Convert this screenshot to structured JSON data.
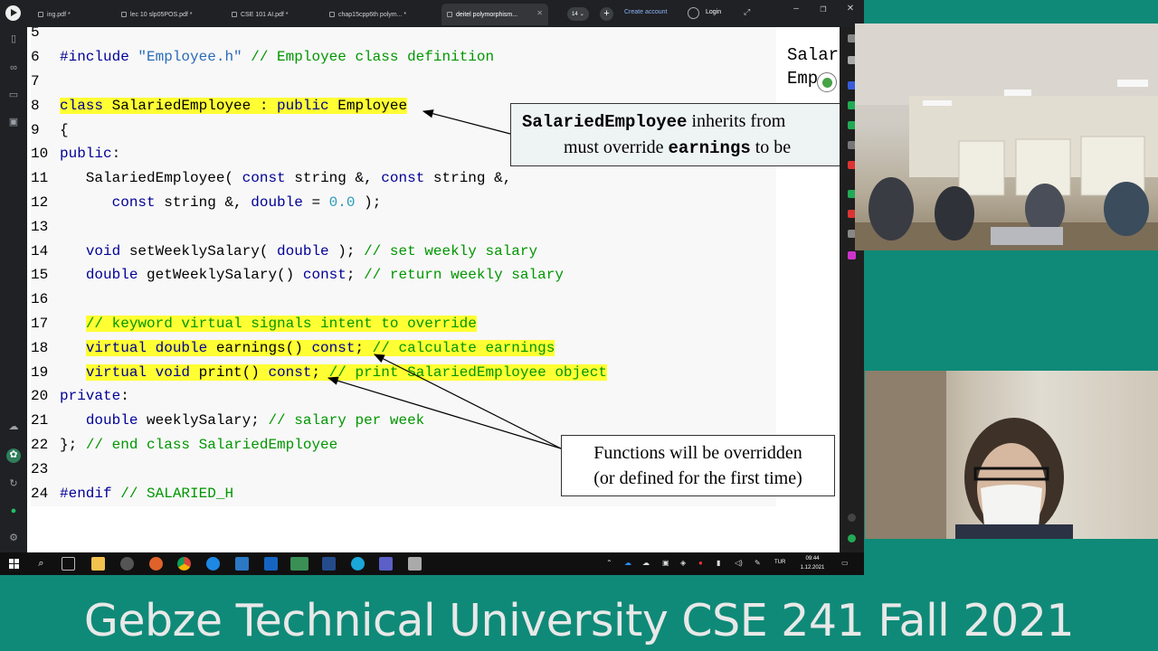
{
  "browser": {
    "tabs": [
      {
        "label": "ing.pdf *",
        "active": false
      },
      {
        "label": "lec 10 slp05POS.pdf *",
        "active": false
      },
      {
        "label": "CSE 101 AI.pdf *",
        "active": false
      },
      {
        "label": "chap15cpp6th polym... *",
        "active": false
      },
      {
        "label": "deitel polymorphism...",
        "active": true
      }
    ],
    "tab_count": "14",
    "create_account": "Create account",
    "login": "Login"
  },
  "code": {
    "first_line_number": "5",
    "lines": [
      {
        "n": "6",
        "text": "#include \"Employee.h\" // Employee class definition"
      },
      {
        "n": "7",
        "text": ""
      },
      {
        "n": "8",
        "text": "class SalariedEmployee : public Employee"
      },
      {
        "n": "9",
        "text": "{"
      },
      {
        "n": "10",
        "text": "public:"
      },
      {
        "n": "11",
        "text": "   SalariedEmployee( const string &, const string &,"
      },
      {
        "n": "12",
        "text": "      const string &, double = 0.0 );"
      },
      {
        "n": "13",
        "text": ""
      },
      {
        "n": "14",
        "text": "   void setWeeklySalary( double ); // set weekly salary"
      },
      {
        "n": "15",
        "text": "   double getWeeklySalary() const; // return weekly salary"
      },
      {
        "n": "16",
        "text": ""
      },
      {
        "n": "17",
        "text": "   // keyword virtual signals intent to override"
      },
      {
        "n": "18",
        "text": "   virtual double earnings() const; // calculate earnings"
      },
      {
        "n": "19",
        "text": "   virtual void print() const; // print SalariedEmployee object"
      },
      {
        "n": "20",
        "text": "private:"
      },
      {
        "n": "21",
        "text": "   double weeklySalary; // salary per week"
      },
      {
        "n": "22",
        "text": "}; // end class SalariedEmployee"
      },
      {
        "n": "23",
        "text": ""
      },
      {
        "n": "24",
        "text": "#endif // SALARIED_H"
      }
    ]
  },
  "callouts": {
    "top": {
      "code1": "SalariedEmployee",
      "text1": " inherits from",
      "text2": "must override ",
      "code2": "earnings",
      "text3": " to be"
    },
    "bottom": {
      "line1": "Functions will be overridden",
      "line2": "(or defined for the first time)"
    }
  },
  "slide_corner": {
    "line1": "Salar",
    "line2": "Emp"
  },
  "taskbar": {
    "language": "TUR",
    "time": "09:44",
    "date": "1.12.2021"
  },
  "banner": {
    "text": "Gebze Technical University CSE 241 Fall 2021"
  },
  "colors": {
    "banner_bg": "#0f8a78",
    "highlight": "#ffff33",
    "keyword": "#000096",
    "comment": "#009600"
  }
}
